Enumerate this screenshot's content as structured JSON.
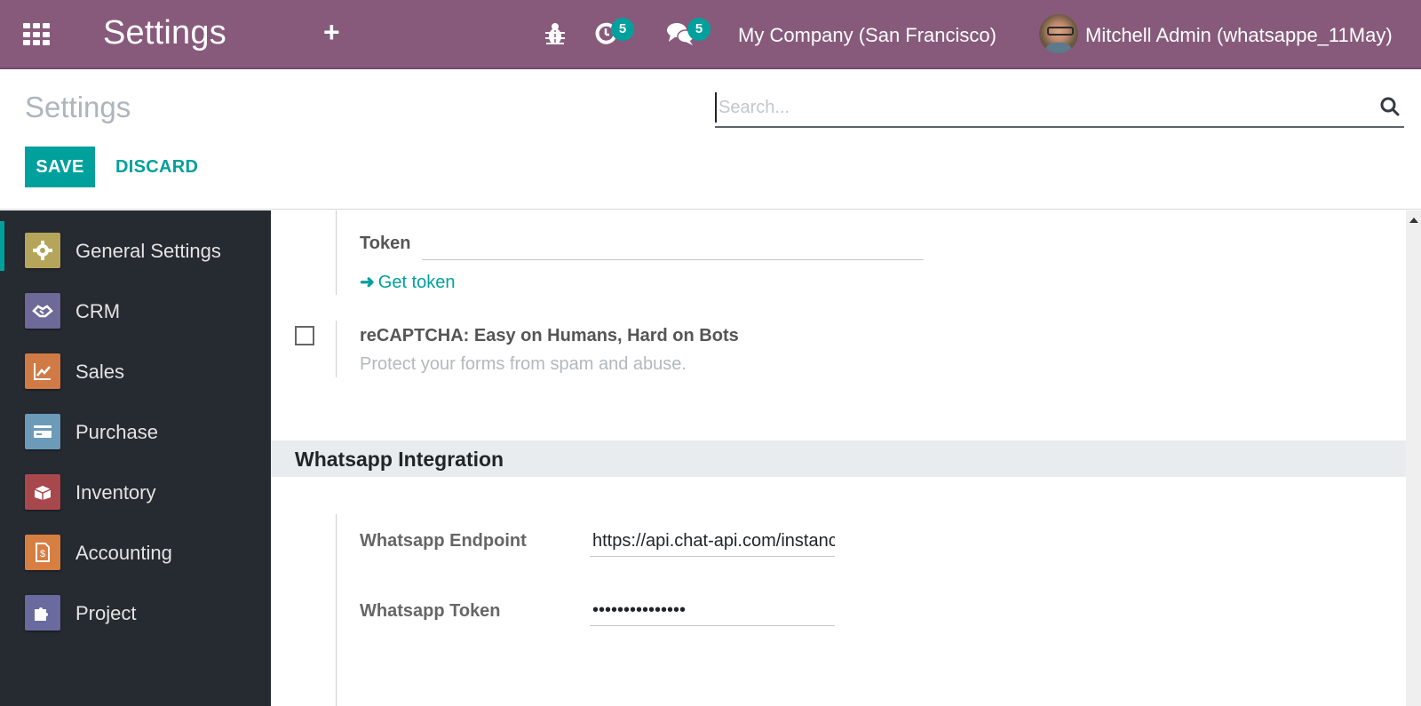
{
  "navbar": {
    "app_title": "Settings",
    "activity_count": "5",
    "messages_count": "5",
    "company": "My Company (San Francisco)",
    "user": "Mitchell Admin (whatsappe_11May)",
    "colors": {
      "brand": "#875a7b",
      "badge": "#00a09d"
    }
  },
  "control_panel": {
    "breadcrumb": "Settings",
    "search": {
      "placeholder": "Search...",
      "value": ""
    },
    "save_label": "SAVE",
    "discard_label": "DISCARD"
  },
  "sidebar": {
    "items": [
      {
        "label": "General Settings",
        "icon": "gear-icon",
        "color": "#b4a55a",
        "active": true
      },
      {
        "label": "CRM",
        "icon": "handshake-icon",
        "color": "#6d6a99",
        "active": false
      },
      {
        "label": "Sales",
        "icon": "chart-line-icon",
        "color": "#d07a45",
        "active": false
      },
      {
        "label": "Purchase",
        "icon": "credit-card-icon",
        "color": "#6b9bb8",
        "active": false
      },
      {
        "label": "Inventory",
        "icon": "box-icon",
        "color": "#a8484c",
        "active": false
      },
      {
        "label": "Accounting",
        "icon": "invoice-icon",
        "color": "#d77e42",
        "active": false
      },
      {
        "label": "Project",
        "icon": "puzzle-icon",
        "color": "#6a6a9e",
        "active": false
      }
    ]
  },
  "content": {
    "token": {
      "label": "Token",
      "value": "",
      "link": "Get token"
    },
    "recaptcha": {
      "checked": false,
      "title": "reCAPTCHA: Easy on Humans, Hard on Bots",
      "description": "Protect your forms from spam and abuse."
    },
    "whatsapp": {
      "section_title": "Whatsapp Integration",
      "endpoint_label": "Whatsapp Endpoint",
      "endpoint_value": "https://api.chat-api.com/instance",
      "token_label": "Whatsapp Token",
      "token_value": "•••••••••••••••"
    }
  }
}
